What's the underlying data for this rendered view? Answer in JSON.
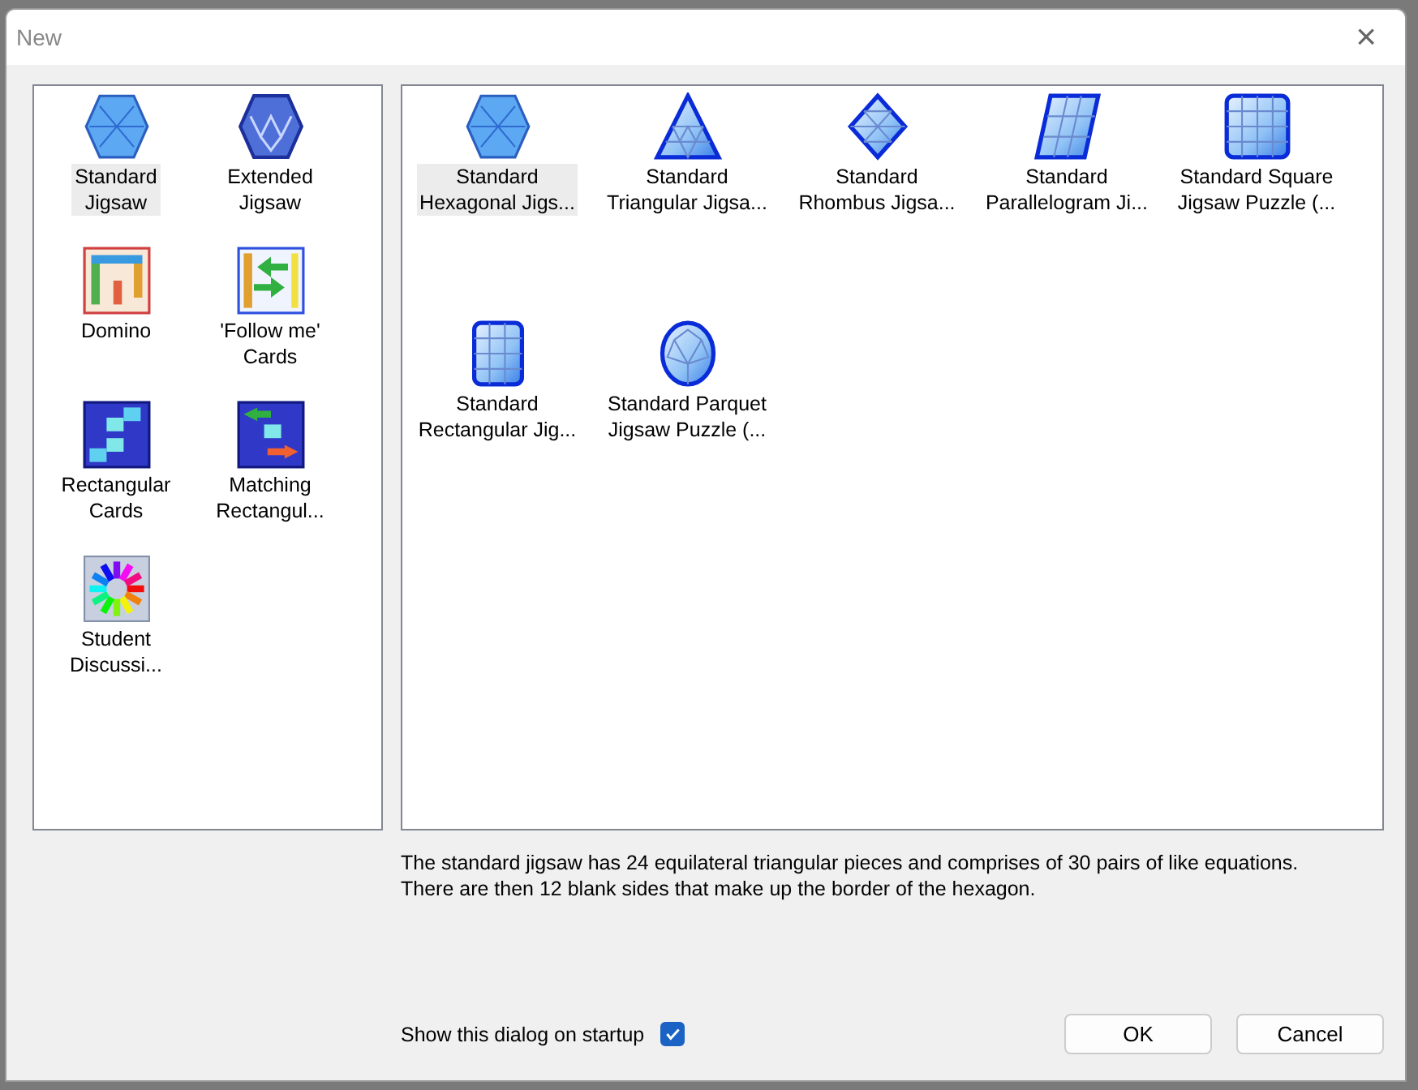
{
  "window": {
    "title": "New",
    "close": "×"
  },
  "categories": [
    {
      "lines": [
        "Standard",
        "Jigsaw"
      ],
      "kind": "hexdots",
      "selected": true
    },
    {
      "lines": [
        "Extended",
        "Jigsaw"
      ],
      "kind": "hexfacet",
      "selected": false
    },
    {
      "lines": [
        "Domino"
      ],
      "kind": "domino",
      "selected": false
    },
    {
      "lines": [
        "'Follow me'",
        "Cards"
      ],
      "kind": "follow",
      "selected": false
    },
    {
      "lines": [
        "Rectangular",
        "Cards"
      ],
      "kind": "rectcards",
      "selected": false
    },
    {
      "lines": [
        "Matching",
        "Rectangul..."
      ],
      "kind": "matching",
      "selected": false
    },
    {
      "lines": [
        "Student",
        "Discussi..."
      ],
      "kind": "wheel",
      "selected": false
    }
  ],
  "templates": [
    {
      "lines": [
        "Standard",
        "Hexagonal Jigs..."
      ],
      "kind": "hexdots",
      "selected": true
    },
    {
      "lines": [
        "Standard",
        "Triangular Jigsa..."
      ],
      "kind": "triangle",
      "selected": false
    },
    {
      "lines": [
        "Standard",
        "Rhombus Jigsa..."
      ],
      "kind": "rhombus",
      "selected": false
    },
    {
      "lines": [
        "Standard",
        "Parallelogram Ji..."
      ],
      "kind": "parallelogram",
      "selected": false
    },
    {
      "lines": [
        "Standard Square",
        "Jigsaw Puzzle (..."
      ],
      "kind": "square",
      "selected": false
    },
    {
      "lines": [
        "Standard",
        "Rectangular Jig..."
      ],
      "kind": "rectangle",
      "selected": false
    },
    {
      "lines": [
        "Standard Parquet",
        "Jigsaw Puzzle (..."
      ],
      "kind": "oval",
      "selected": false
    }
  ],
  "description": [
    "The standard jigsaw has 24 equilateral triangular pieces and comprises of 30 pairs of like equations.",
    "There are then 12 blank sides that make up the border of the hexagon."
  ],
  "startup": {
    "label": "Show this dialog on startup",
    "checked": true
  },
  "buttons": [
    "OK",
    "Cancel"
  ]
}
